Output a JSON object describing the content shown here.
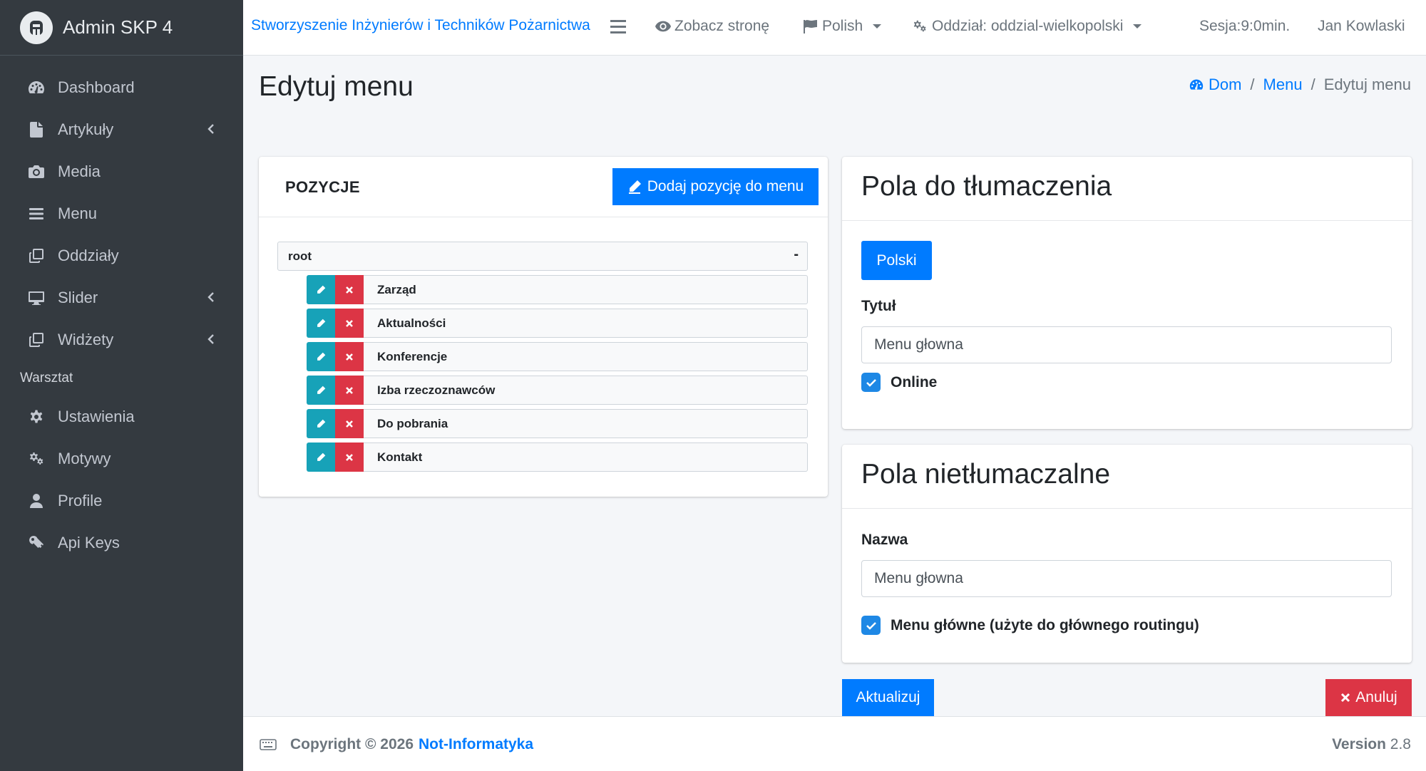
{
  "brand": {
    "name": "Admin SKP 4"
  },
  "sidebar": {
    "items": [
      {
        "label": "Dashboard",
        "icon": "tachometer-icon"
      },
      {
        "label": "Artykuły",
        "icon": "file-icon",
        "expandable": true
      },
      {
        "label": "Media",
        "icon": "camera-icon"
      },
      {
        "label": "Menu",
        "icon": "bars-icon"
      },
      {
        "label": "Oddziały",
        "icon": "clone-icon"
      },
      {
        "label": "Slider",
        "icon": "desktop-icon",
        "expandable": true
      },
      {
        "label": "Widżety",
        "icon": "clone-icon",
        "expandable": true
      }
    ],
    "section_header": "Warsztat",
    "items2": [
      {
        "label": "Ustawienia",
        "icon": "cog-icon"
      },
      {
        "label": "Motywy",
        "icon": "cogs-icon"
      },
      {
        "label": "Profile",
        "icon": "user-icon"
      },
      {
        "label": "Api Keys",
        "icon": "key-icon"
      }
    ]
  },
  "topbar": {
    "site_name": "Stworzyszenie Inżynierów i Techników Pożarnictwa",
    "view_site": "Zobacz stronę",
    "language": "Polish",
    "branch": "Oddział: oddzial-wielkopolski",
    "session": "Sesja:9:0min.",
    "user": "Jan Kowlaski"
  },
  "page": {
    "title": "Edytuj menu",
    "breadcrumb": {
      "home": "Dom",
      "menu": "Menu",
      "current": "Edytuj menu",
      "separator": "/"
    }
  },
  "positions": {
    "title": "POZYCJE",
    "add_button": "Dodaj pozycję do menu",
    "root_label": "root",
    "root_toggle": "-",
    "items": [
      "Zarząd",
      "Aktualności",
      "Konferencje",
      "Izba rzeczoznawców",
      "Do pobrania",
      "Kontakt"
    ]
  },
  "translatable": {
    "title": "Pola do tłumaczenia",
    "language_button": "Polski",
    "title_label": "Tytuł",
    "title_value": "Menu głowna",
    "online_label": "Online",
    "online_checked": true
  },
  "non_translatable": {
    "title": "Pola nietłumaczalne",
    "name_label": "Nazwa",
    "name_value": "Menu głowna",
    "main_menu_label": "Menu główne (użyte do głównego routingu)",
    "main_menu_checked": true
  },
  "actions": {
    "update": "Aktualizuj",
    "cancel": "Anuluj"
  },
  "footer": {
    "copyright": "Copyright © 2026",
    "company": "Not-Informatyka",
    "version_label": "Version",
    "version": "2.8"
  },
  "colors": {
    "primary": "#007bff",
    "danger": "#dc3545",
    "info": "#17a2b8",
    "sidebar": "#343a40",
    "checkbox": "#1e88e5"
  }
}
